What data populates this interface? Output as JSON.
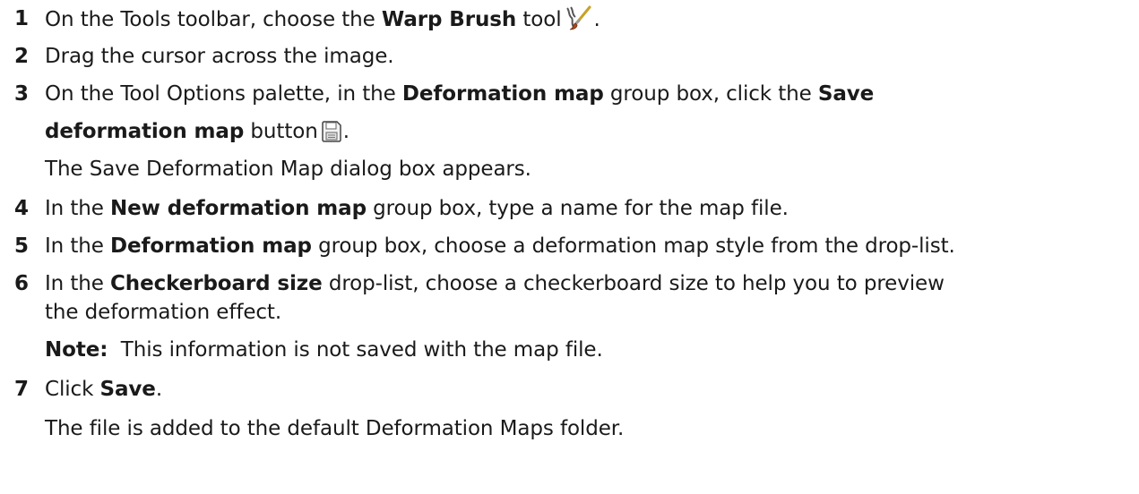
{
  "steps": [
    {
      "number": "1",
      "lines": [
        {
          "p1": "On the Tools toolbar, choose the ",
          "b1": "Warp Brush",
          "p2": " tool",
          "p3": "."
        }
      ]
    },
    {
      "number": "2",
      "lines": [
        {
          "p1": "Drag the cursor across the image."
        }
      ]
    },
    {
      "number": "3",
      "lines": [
        {
          "p1": "On the Tool Options palette, in the ",
          "b1": "Deformation map",
          "p2": " group box, click the ",
          "b2": "Save"
        },
        {
          "b1": "deformation map",
          "p1": " button",
          "p2": "."
        },
        {
          "p1": "The Save Deformation Map dialog box appears."
        }
      ]
    },
    {
      "number": "4",
      "lines": [
        {
          "p1": "In the ",
          "b1": "New deformation map",
          "p2": " group box, type a name for the map file."
        }
      ]
    },
    {
      "number": "5",
      "lines": [
        {
          "p1": "In the ",
          "b1": "Deformation map",
          "p2": " group box, choose a deformation map style from the drop-list."
        }
      ]
    },
    {
      "number": "6",
      "lines": [
        {
          "p1": "In the ",
          "b1": "Checkerboard size",
          "p2": " drop-list, choose a checkerboard size to help you to preview"
        },
        {
          "p1": "the deformation effect."
        },
        {
          "b1": "Note:",
          "p1": "  This information is not saved with the map file."
        }
      ]
    },
    {
      "number": "7",
      "lines": [
        {
          "p1": "Click ",
          "b1": "Save",
          "p2": "."
        },
        {
          "p1": "The file is added to the default Deformation Maps folder."
        }
      ]
    }
  ],
  "icons": {
    "warp_brush": "warp-brush-icon",
    "save_map": "save-icon"
  }
}
